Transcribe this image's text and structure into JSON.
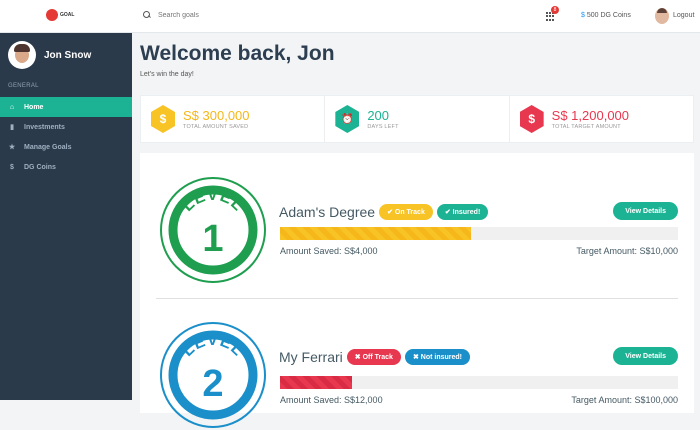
{
  "header": {
    "logo_text": "GOAL",
    "search_placeholder": "Search goals",
    "notification_count": "8",
    "coins_symbol": "$",
    "coins_label": "500 DG Coins",
    "logout_label": "Logout"
  },
  "sidebar": {
    "user_name": "Jon Snow",
    "section_label": "GENERAL",
    "items": [
      {
        "label": "Home",
        "icon": "home-icon",
        "glyph": "⌂",
        "active": true
      },
      {
        "label": "Investments",
        "icon": "bar-chart-icon",
        "glyph": "▮",
        "active": false
      },
      {
        "label": "Manage Goals",
        "icon": "star-icon",
        "glyph": "★",
        "active": false
      },
      {
        "label": "DG Coins",
        "icon": "dollar-icon",
        "glyph": "$",
        "active": false
      }
    ]
  },
  "main": {
    "welcome": "Welcome back, Jon",
    "subtitle": "Let's win the day!",
    "stats": [
      {
        "value": "S$ 300,000",
        "label": "TOTAL AMOUNT SAVED",
        "icon": "dollar-icon",
        "glyph": "$",
        "color": "#f7c325"
      },
      {
        "value": "200",
        "label": "DAYS LEFT",
        "icon": "alarm-clock-icon",
        "glyph": "⏰",
        "color": "#1bb394"
      },
      {
        "value": "S$ 1,200,000",
        "label": "TOTAL TARGET AMOUNT",
        "icon": "dollar-icon",
        "glyph": "$",
        "color": "#e8384f"
      }
    ],
    "goals": [
      {
        "level_word": "LEVEL",
        "level_number": "1",
        "level_color": "#1e9e4e",
        "title": "Adam's Degree",
        "track_status": "On Track",
        "track_color": "#f7c325",
        "insured_status": "Insured!",
        "insured_color": "#1bb394",
        "view_label": "View Details",
        "progress": 0.48,
        "progress_style": "yellow",
        "amount_saved": "Amount Saved: S$4,000",
        "target_amount": "Target Amount: S$10,000"
      },
      {
        "level_word": "LEVEL",
        "level_number": "2",
        "level_color": "#1b8fc9",
        "title": "My Ferrari",
        "track_status": "Off Track",
        "track_color": "#e8384f",
        "insured_status": "Not insured!",
        "insured_color": "#1b8fc9",
        "view_label": "View Details",
        "progress": 0.18,
        "progress_style": "red",
        "amount_saved": "Amount Saved: S$12,000",
        "target_amount": "Target Amount: S$100,000"
      }
    ]
  }
}
